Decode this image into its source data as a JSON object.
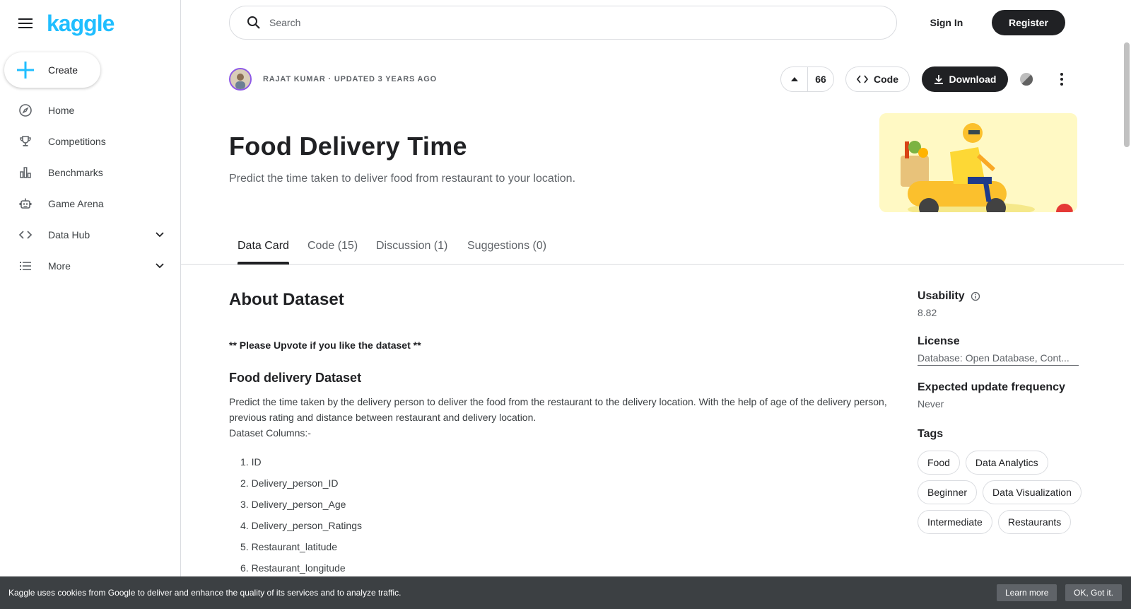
{
  "app": {
    "logo": "kaggle"
  },
  "sidebar": {
    "create_label": "Create",
    "items": [
      {
        "label": "Home",
        "icon": "compass-icon"
      },
      {
        "label": "Competitions",
        "icon": "trophy-icon"
      },
      {
        "label": "Benchmarks",
        "icon": "bar-chart-icon"
      },
      {
        "label": "Game Arena",
        "icon": "robot-icon"
      },
      {
        "label": "Data Hub",
        "icon": "code-icon"
      },
      {
        "label": "More",
        "icon": "list-icon"
      }
    ]
  },
  "header": {
    "search_placeholder": "Search",
    "signin_label": "Sign In",
    "register_label": "Register"
  },
  "dataset": {
    "author_line": "RAJAT KUMAR · UPDATED 3 YEARS AGO",
    "vote_count": "66",
    "code_label": "Code",
    "download_label": "Download",
    "title": "Food Delivery Time",
    "subtitle": "Predict the time taken to deliver food from restaurant to your location."
  },
  "tabs": [
    {
      "label": "Data Card"
    },
    {
      "label": "Code (15)"
    },
    {
      "label": "Discussion (1)"
    },
    {
      "label": "Suggestions (0)"
    }
  ],
  "content": {
    "about_heading": "About Dataset",
    "upvote_note": "** Please Upvote if you like the dataset **",
    "food_heading": "Food delivery Dataset",
    "description": "Predict the time taken by the delivery person to deliver the food from the restaurant to the delivery location. With the help of age of the delivery person, previous rating and distance between restaurant and delivery location.",
    "columns_intro": "Dataset Columns:-",
    "columns": [
      "1. ID",
      "2. Delivery_person_ID",
      "3. Delivery_person_Age",
      "4. Delivery_person_Ratings",
      "5. Restaurant_latitude",
      "6. Restaurant_longitude"
    ]
  },
  "panel": {
    "usability_label": "Usability",
    "usability_value": "8.82",
    "license_label": "License",
    "license_value": "Database: Open Database, Cont...",
    "frequency_label": "Expected update frequency",
    "frequency_value": "Never",
    "tags_label": "Tags",
    "tags": [
      "Food",
      "Data Analytics",
      "Beginner",
      "Data Visualization",
      "Intermediate",
      "Restaurants"
    ]
  },
  "cookie": {
    "text": "Kaggle uses cookies from Google to deliver and enhance the quality of its services and to analyze traffic.",
    "learn_label": "Learn more",
    "ok_label": "OK, Got it."
  },
  "colors": {
    "brand": "#20beff",
    "dark": "#202124",
    "text_secondary": "#5f6368",
    "border": "#dadce0",
    "avatar_ring": "#8e59e8"
  }
}
